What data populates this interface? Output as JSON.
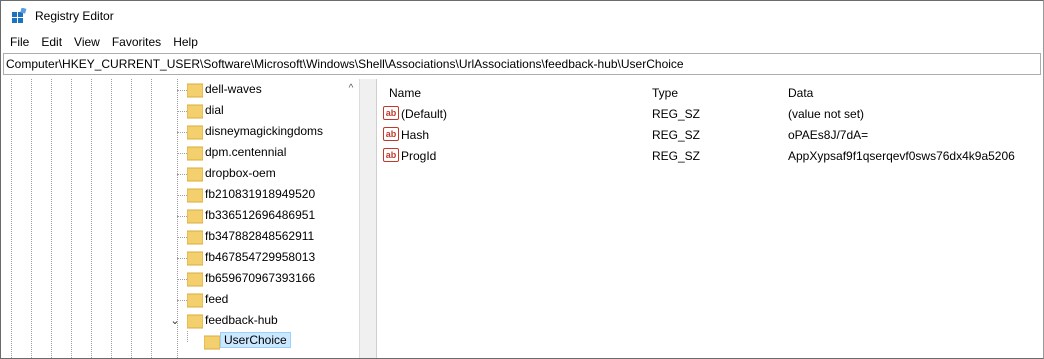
{
  "window": {
    "title": "Registry Editor"
  },
  "menu": [
    "File",
    "Edit",
    "View",
    "Favorites",
    "Help"
  ],
  "address": "Computer\\HKEY_CURRENT_USER\\Software\\Microsoft\\Windows\\Shell\\Associations\\UrlAssociations\\feedback-hub\\UserChoice",
  "tree": {
    "items": [
      {
        "label": "dell-waves"
      },
      {
        "label": "dial"
      },
      {
        "label": "disneymagickingdoms"
      },
      {
        "label": "dpm.centennial"
      },
      {
        "label": "dropbox-oem"
      },
      {
        "label": "fb210831918949520"
      },
      {
        "label": "fb336512696486951"
      },
      {
        "label": "fb347882848562911"
      },
      {
        "label": "fb467854729958013"
      },
      {
        "label": "fb659670967393166"
      },
      {
        "label": "feed"
      },
      {
        "label": "feedback-hub",
        "expander": "⌄"
      },
      {
        "label": "UserChoice"
      }
    ],
    "scroll_up": "^"
  },
  "values": {
    "headers": {
      "name": "Name",
      "type": "Type",
      "data": "Data"
    },
    "icon_text": "ab",
    "rows": [
      {
        "name": "(Default)",
        "type": "REG_SZ",
        "data": "(value not set)"
      },
      {
        "name": "Hash",
        "type": "REG_SZ",
        "data": "oPAEs8J/7dA="
      },
      {
        "name": "ProgId",
        "type": "REG_SZ",
        "data": "AppXypsaf9f1qserqevf0sws76dx4k9a5206"
      }
    ]
  },
  "colors": {
    "folder": "#f4cf6e",
    "selection": "#cce8ff",
    "icon_red": "#c0392b"
  }
}
